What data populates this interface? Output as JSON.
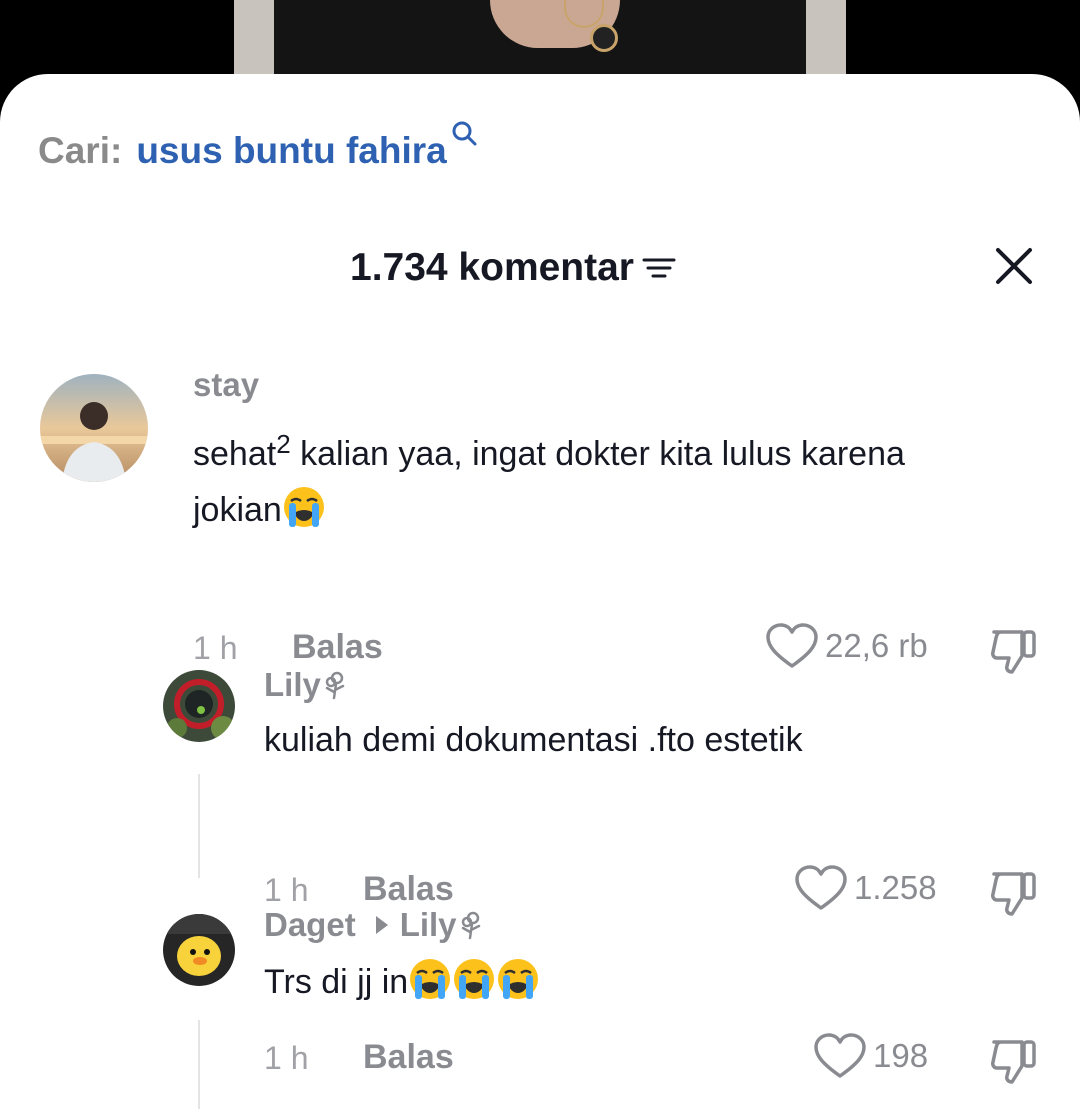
{
  "search": {
    "prefix": "Cari:",
    "query": "usus buntu fahira",
    "icon": "search-icon",
    "query_color": "#2e61b1"
  },
  "header": {
    "count_label": "1.734 komentar",
    "sort_icon": "sort-icon",
    "close_icon": "close-icon"
  },
  "comments": [
    {
      "username": "stay",
      "text_main": "sehat",
      "text_sup": "2",
      "text_line1_rest": " kalian yaa, ingat dokter kita lulus karena",
      "text_line2": "jokian",
      "emoji": "loudly-crying-face",
      "time": "1 h",
      "reply_label": "Balas",
      "likes": "22,6 rb"
    },
    {
      "username": "Lily",
      "username_icon": "flower-icon",
      "text": "kuliah demi dokumentasi .fto estetik",
      "time": "1 h",
      "reply_label": "Balas",
      "likes": "1.258"
    },
    {
      "username": "Daget",
      "reply_to": "Lily",
      "reply_to_icon": "flower-icon",
      "text": "Trs di jj in",
      "emoji_count": 3,
      "time": "1 h",
      "reply_label": "Balas",
      "likes": "198"
    }
  ]
}
